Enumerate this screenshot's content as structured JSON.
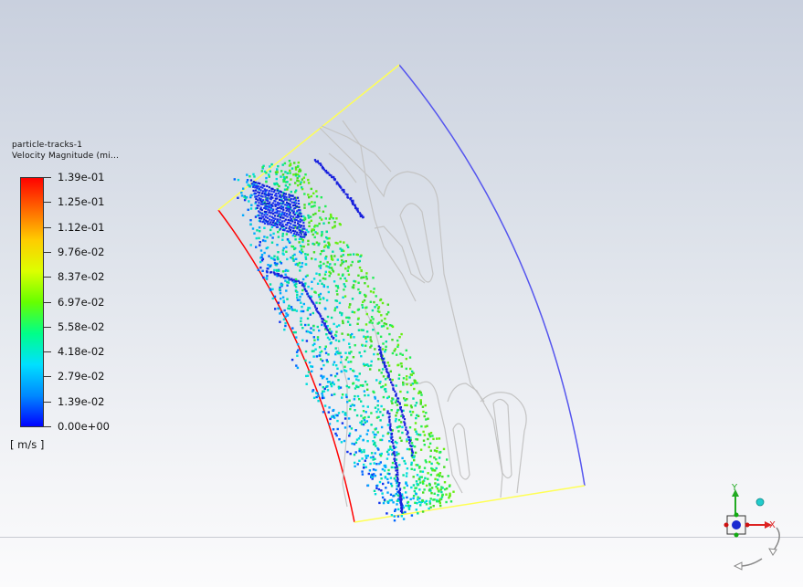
{
  "legend": {
    "title_line1": "particle-tracks-1",
    "title_line2": "Velocity Magnitude (mi...",
    "units": "[ m/s ]",
    "ticks": [
      "1.39e-01",
      "1.25e-01",
      "1.12e-01",
      "9.76e-02",
      "8.37e-02",
      "6.97e-02",
      "5.58e-02",
      "4.18e-02",
      "2.79e-02",
      "1.39e-02",
      "0.00e+00"
    ],
    "colormap": [
      "#0000ff",
      "#0088ff",
      "#00e0ff",
      "#00ff88",
      "#66ff00",
      "#ddff00",
      "#ffcc00",
      "#ff6600",
      "#ff0000"
    ]
  },
  "axes_triad": {
    "x_label": "X",
    "y_label": "Y"
  },
  "boundary_colors": {
    "inlet": "#ff0000",
    "outlet": "#5555ee",
    "periodic": "#ffff55",
    "blades": "#c4c4c4"
  }
}
